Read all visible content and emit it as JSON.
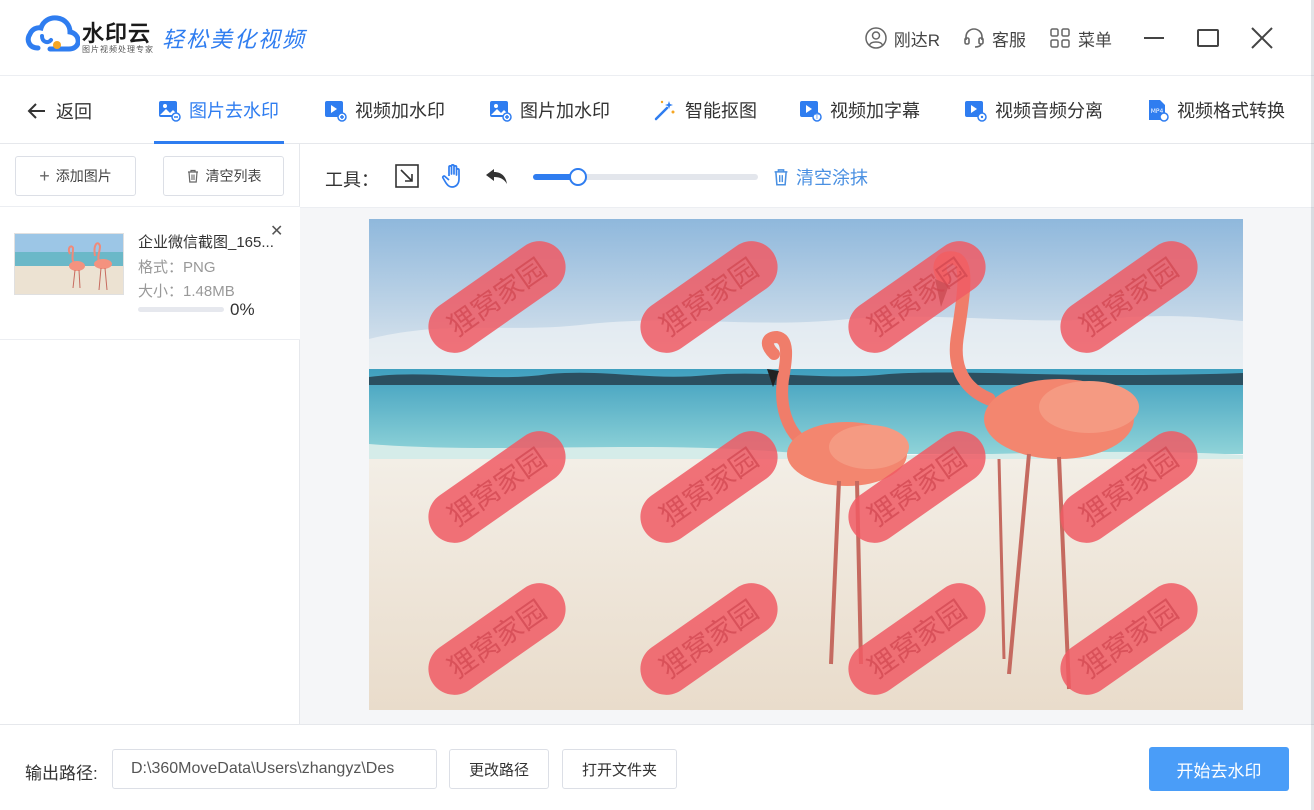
{
  "app": {
    "brand": "水印云",
    "brand_sub": "图片视频处理专家",
    "slogan": "轻松美化视频",
    "user": "刚达R",
    "service": "客服",
    "menu": "菜单"
  },
  "nav": {
    "back": "返回",
    "tabs": [
      {
        "label": "图片去水印",
        "icon": "image-remove-icon",
        "active": true
      },
      {
        "label": "视频加水印",
        "icon": "video-add-icon"
      },
      {
        "label": "图片加水印",
        "icon": "image-add-icon"
      },
      {
        "label": "智能抠图",
        "icon": "magic-wand-icon"
      },
      {
        "label": "视频加字幕",
        "icon": "video-subtitle-icon"
      },
      {
        "label": "视频音频分离",
        "icon": "video-audio-icon"
      },
      {
        "label": "视频格式转换",
        "icon": "mp4-file-icon"
      }
    ]
  },
  "left_panel": {
    "add_image": "添加图片",
    "clear_list": "清空列表",
    "files": [
      {
        "name": "企业微信截图_165...",
        "format": "格式：PNG",
        "size": "大小：1.48MB",
        "progress": "0%",
        "progress_value": 0
      }
    ]
  },
  "toolbar": {
    "label": "工具：",
    "clear_paint": "清空涂抹",
    "brush_size": 0.2
  },
  "canvas": {
    "watermark_text": "狸窝家园"
  },
  "bottom": {
    "output_label": "输出路径:",
    "output_path": "D:\\360MoveData\\Users\\zhangyz\\Des",
    "change_path": "更改路径",
    "open_folder": "打开文件夹",
    "start": "开始去水印"
  },
  "colors": {
    "accent": "#2f7df0",
    "start_button": "#4a9df8",
    "paint": "#f05a64"
  }
}
